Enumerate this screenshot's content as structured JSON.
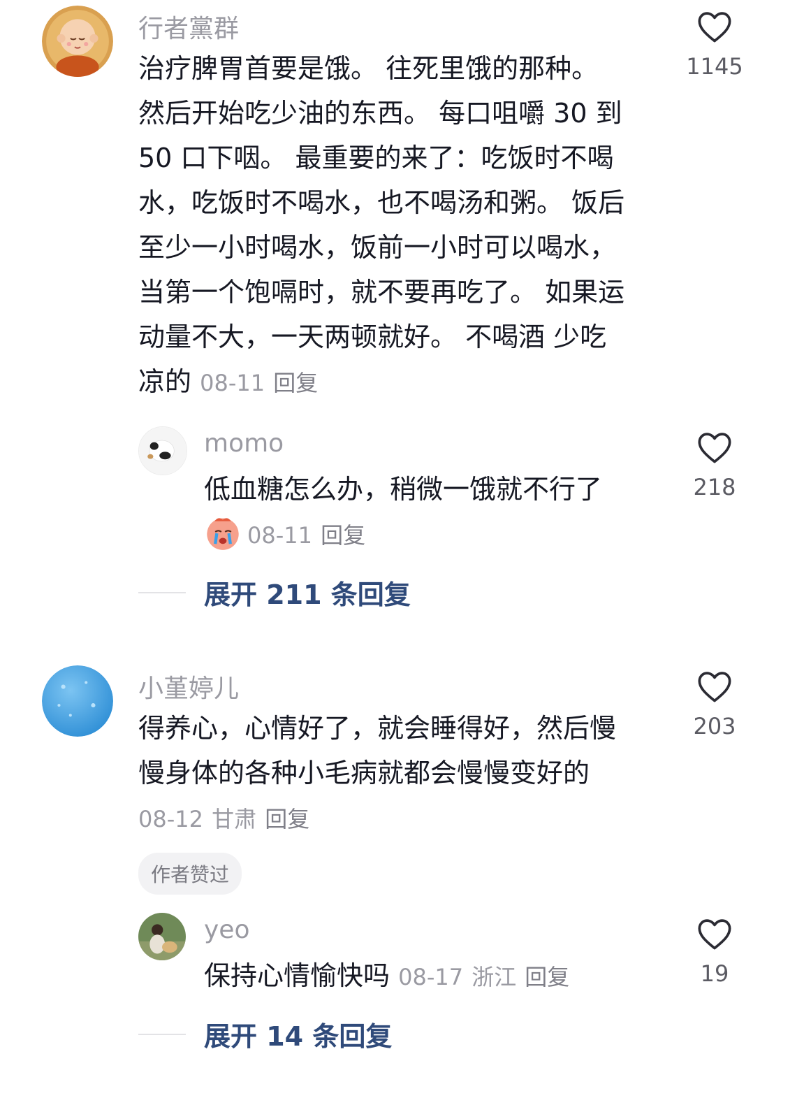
{
  "comments": [
    {
      "username": "行者黨群",
      "lines": [
        "治疗脾胃首要是饿。 往死里饿的那种。",
        "然后开始吃少油的东西。 每口咀嚼 30 到",
        "50 口下咽。  最重要的来了：吃饭时不喝",
        "水，吃饭时不喝水，也不喝汤和粥。 饭后",
        "至少一小时喝水，饭前一小时可以喝水，",
        "当第一个饱嗝时，就不要再吃了。 如果运",
        "动量不大，一天两顿就好。 不喝酒 少吃"
      ],
      "last_line": "凉的",
      "date": "08-11",
      "reply": "回复",
      "likes": "1145",
      "replies": [
        {
          "username": "momo",
          "text": "低血糖怎么办，稍微一饿就不行了",
          "emoji": "crying-face",
          "date": "08-11",
          "reply": "回复",
          "likes": "218"
        }
      ],
      "expand": "展开 211 条回复"
    },
    {
      "username": "小堇婷儿",
      "lines": [
        "得养心，心情好了，就会睡得好，然后慢",
        "慢身体的各种小毛病就都会慢慢变好的"
      ],
      "date": "08-12",
      "location": "甘肃",
      "reply": "回复",
      "badge": "作者赞过",
      "likes": "203",
      "replies": [
        {
          "username": "yeo",
          "text": "保持心情愉快吗",
          "date": "08-17",
          "location": "浙江",
          "reply": "回复",
          "likes": "19"
        }
      ],
      "expand": "展开 14 条回复"
    }
  ],
  "icons": {
    "like": "heart-outline-icon"
  },
  "colors": {
    "link": "#2f4a7a",
    "meta": "#9a9aa2",
    "text": "#161823"
  }
}
